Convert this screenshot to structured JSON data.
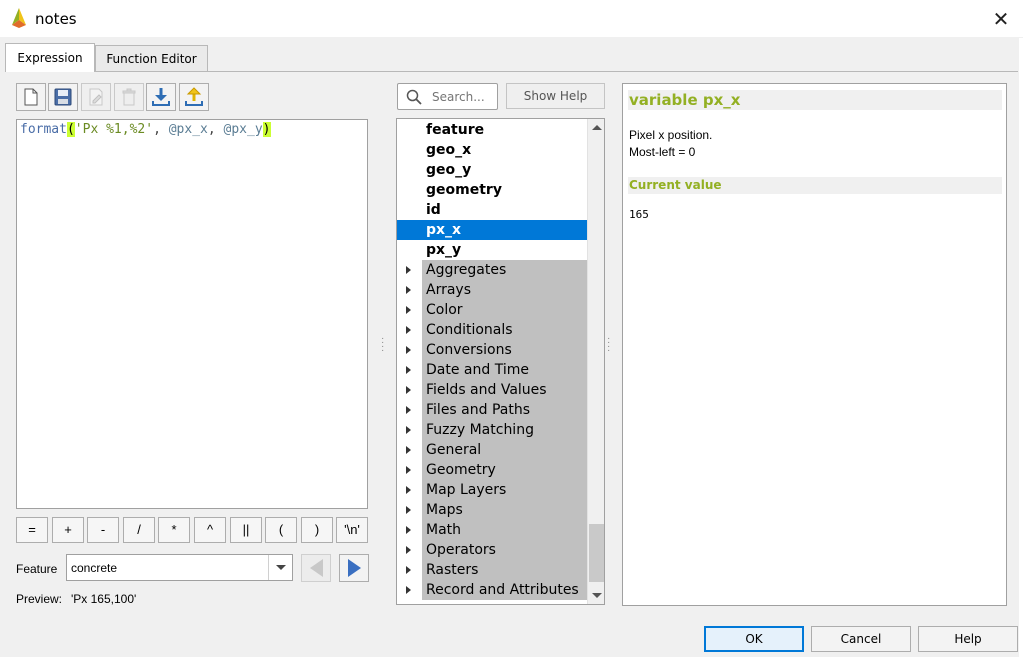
{
  "window": {
    "title": "notes",
    "close_glyph": "✕"
  },
  "tabs": [
    {
      "label": "Expression",
      "active": true
    },
    {
      "label": "Function Editor",
      "active": false
    }
  ],
  "toolbar": {
    "icons": [
      "new-file-icon",
      "save-icon",
      "edit-icon",
      "delete-icon",
      "import-icon",
      "export-icon"
    ]
  },
  "editor": {
    "tokens": {
      "fn": "format",
      "open": "(",
      "str": "'Px %1,%2'",
      "comma1": ", ",
      "var1": "@px_x",
      "comma2": ", ",
      "var2": "@px_y",
      "close": ")"
    }
  },
  "operators": [
    "=",
    "+",
    "-",
    "/",
    "*",
    "^",
    "||",
    "(",
    ")",
    "'\\n'"
  ],
  "feature": {
    "label": "Feature",
    "value": "concrete"
  },
  "preview": {
    "label": "Preview:",
    "value": "'Px 165,100'"
  },
  "search": {
    "placeholder": "Search..."
  },
  "show_help_label": "Show Help",
  "tree": {
    "variables": [
      "feature",
      "geo_x",
      "geo_y",
      "geometry",
      "id",
      "px_x",
      "px_y"
    ],
    "selected": "px_x",
    "groups": [
      "Aggregates",
      "Arrays",
      "Color",
      "Conditionals",
      "Conversions",
      "Date and Time",
      "Fields and Values",
      "Files and Paths",
      "Fuzzy Matching",
      "General",
      "Geometry",
      "Map Layers",
      "Maps",
      "Math",
      "Operators",
      "Rasters",
      "Record and Attributes"
    ]
  },
  "help": {
    "title": "variable px_x",
    "desc_line1": "Pixel x position.",
    "desc_line2": "Most-left = 0",
    "current_value_title": "Current value",
    "current_value": "165",
    "accent_color": "#93b023"
  },
  "buttons": {
    "ok": "OK",
    "cancel": "Cancel",
    "help": "Help"
  },
  "colors": {
    "selection": "#0078d7",
    "group_bg": "#c0c0c0",
    "paren_highlight": "#ccff33"
  }
}
